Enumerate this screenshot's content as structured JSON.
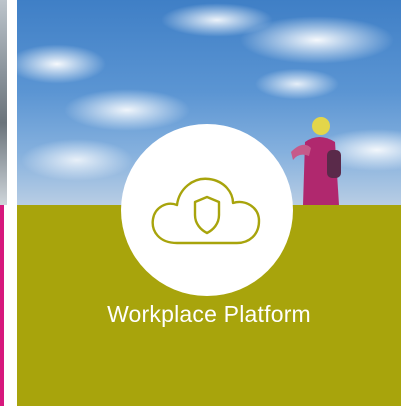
{
  "tile": {
    "title": "Workplace Platform",
    "icon": "cloud-shield-icon"
  },
  "colors": {
    "brand_panel": "#a8a40c",
    "icon_stroke": "#a8a40c",
    "left_accent": "#d7187d",
    "circle_fill": "#ffffff",
    "title_text": "#ffffff"
  }
}
